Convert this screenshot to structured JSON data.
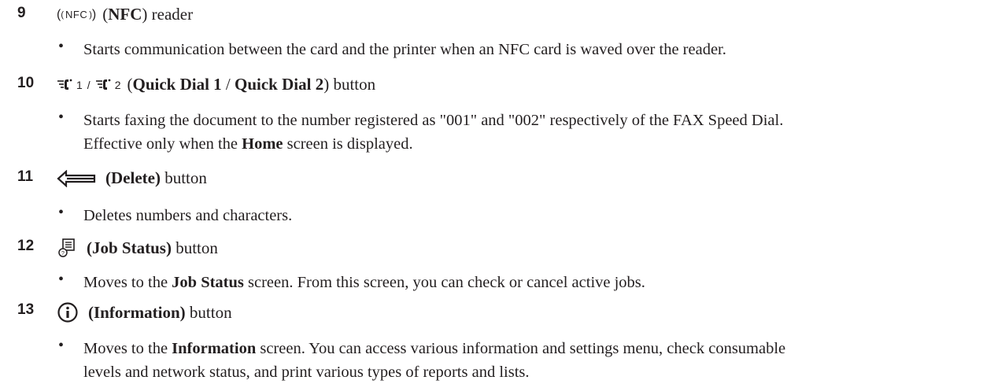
{
  "items": [
    {
      "number": "9",
      "icon": "nfc-icon",
      "icon_text": "NFC",
      "head_bold": "NFC",
      "head_open": "(",
      "head_close": ")",
      "head_suffix": " reader",
      "bullets": [
        "Starts communication between the card and the printer when an NFC card is waved over the reader."
      ]
    },
    {
      "number": "10",
      "icon": "quick-dial-icon",
      "icon_num_1": "1",
      "icon_sep": "/",
      "icon_num_2": "2",
      "head_bold_1": "Quick Dial 1",
      "head_sep": " / ",
      "head_bold_2": "Quick Dial 2",
      "head_suffix": " button",
      "bullet_line_1": "Starts faxing the document to the number registered as \"001\" and \"002\" respectively of the FAX Speed Dial.",
      "bullet_line_2a": "Effective only when the ",
      "bullet_line_2b": "Home",
      "bullet_line_2c": " screen is displayed."
    },
    {
      "number": "11",
      "icon": "delete-arrow-icon",
      "head_bold": "(Delete)",
      "head_suffix": " button",
      "bullets": [
        "Deletes numbers and characters."
      ]
    },
    {
      "number": "12",
      "icon": "job-status-icon",
      "head_bold": "(Job Status)",
      "head_suffix": " button",
      "bullet_a": "Moves to the ",
      "bullet_b": "Job Status",
      "bullet_c": " screen. From this screen, you can check or cancel active jobs."
    },
    {
      "number": "13",
      "icon": "information-icon",
      "head_bold": "(Information)",
      "head_suffix": " button",
      "bullet_a": "Moves to the ",
      "bullet_b": "Information",
      "bullet_c": " screen. You can access various information and settings menu, check consumable",
      "bullet_line_2": "levels and network status, and print various types of reports and lists."
    }
  ],
  "bullet_char": "•"
}
